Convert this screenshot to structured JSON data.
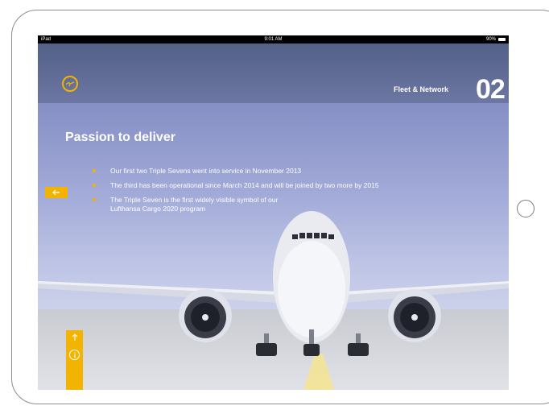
{
  "status_bar": {
    "device": "iPad",
    "time": "9:01 AM",
    "battery": "90%"
  },
  "header": {
    "section_label": "Fleet & Network",
    "section_number": "02"
  },
  "content": {
    "headline": "Passion to deliver",
    "bullets": [
      "Our first two Triple Sevens went into service in November 2013",
      "The third has been operational since March 2014 and will be joined by two more by 2015",
      "The Triple Seven is the first widely visible symbol of our",
      "Lufthansa Cargo 2020 program"
    ]
  },
  "icons": {
    "logo": "crane-logo-icon",
    "back": "arrow-left-icon",
    "up": "arrow-up-icon",
    "info": "info-icon",
    "wifi": "wifi-icon",
    "battery": "battery-icon",
    "home": "home-button-icon"
  },
  "colors": {
    "accent": "#f2b400",
    "header_band": "#5a6590",
    "sky": "#a0a9d7"
  }
}
